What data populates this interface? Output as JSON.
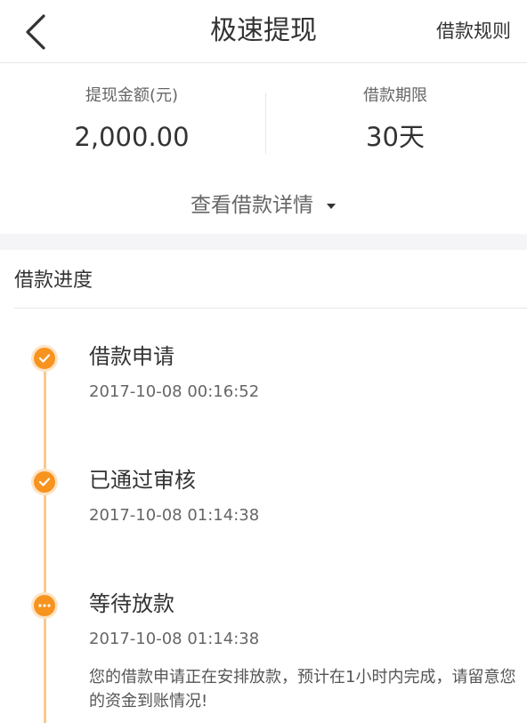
{
  "header": {
    "title": "极速提现",
    "rules_link": "借款规则",
    "back_icon": "chevron-left-icon"
  },
  "summary": {
    "amount_label": "提现金额(元)",
    "amount_value": "2,000.00",
    "term_label": "借款期限",
    "term_value": "30天",
    "details_toggle": "查看借款详情",
    "toggle_icon": "caret-down-icon"
  },
  "progress": {
    "title": "借款进度",
    "steps": [
      {
        "title": "借款申请",
        "time": "2017-10-08 00:16:52",
        "status": "done",
        "icon": "check-icon"
      },
      {
        "title": "已通过审核",
        "time": "2017-10-08 01:14:38",
        "status": "done",
        "icon": "check-icon"
      },
      {
        "title": "等待放款",
        "time": "2017-10-08 01:14:38",
        "status": "pending",
        "icon": "ellipsis-icon",
        "description": "您的借款申请正在安排放款，预计在1小时内完成，请留意您的资金到账情况!"
      }
    ]
  },
  "colors": {
    "accent": "#f7931e",
    "accent_light": "#fde3c4",
    "timeline": "#f9c98d",
    "text_primary": "#333333",
    "text_secondary": "#666666",
    "divider": "#e6e6e6",
    "section_gap": "#f5f5f8"
  }
}
